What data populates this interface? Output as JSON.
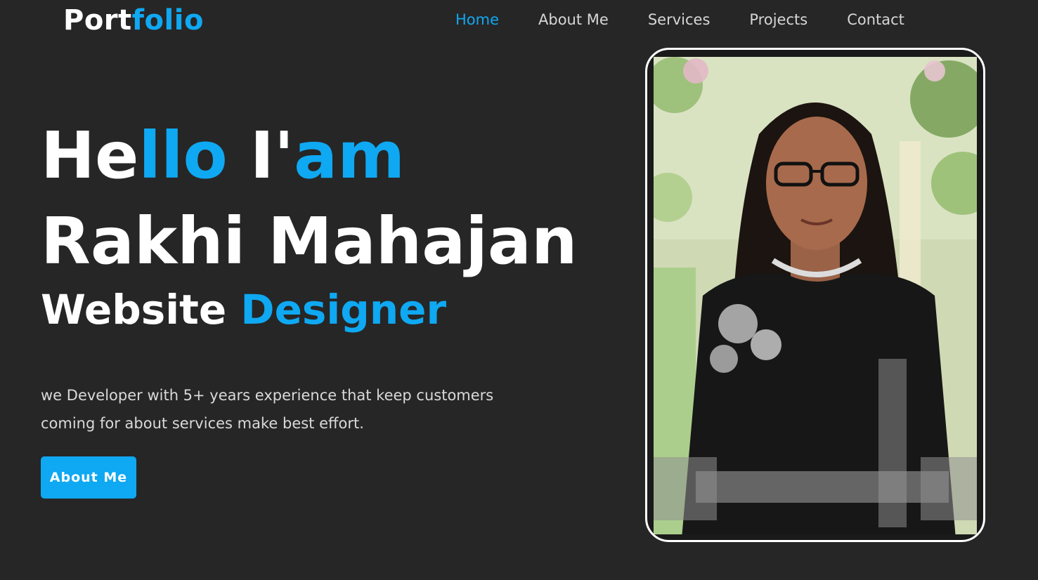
{
  "header": {
    "logo_part1": "Port",
    "logo_part2": "folio",
    "logo_part3": "o"
  },
  "nav": {
    "items": [
      {
        "label": "Home",
        "active": true
      },
      {
        "label": "About Me",
        "active": false
      },
      {
        "label": "Services",
        "active": false
      },
      {
        "label": "Projects",
        "active": false
      },
      {
        "label": "Contact",
        "active": false
      }
    ]
  },
  "hero": {
    "greeting_white1": "He",
    "greeting_blue1": "llo",
    "greeting_white2": " I'",
    "greeting_blue2": "am",
    "name": "Rakhi Mahajan",
    "role_white": "Website ",
    "role_blue": "Designer",
    "description": "we Developer with 5+ years experience that keep customers coming for about services make best effort.",
    "cta_label": "About Me"
  },
  "colors": {
    "background": "#262626",
    "accent": "#0fa8f2",
    "text": "#ffffff"
  },
  "photo": {
    "alt": "Portrait photo"
  }
}
